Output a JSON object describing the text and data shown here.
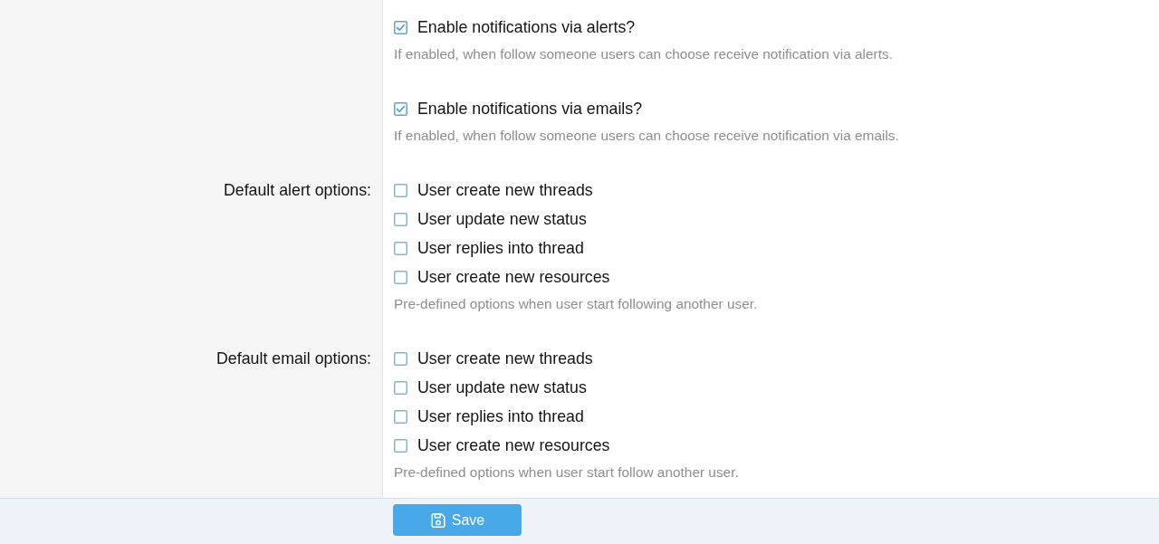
{
  "form": {
    "rows": [
      {
        "options": [
          {
            "label": "Enable notifications via alerts?",
            "checked": true
          }
        ],
        "explain": "If enabled, when follow someone users can choose receive notification via alerts."
      },
      {
        "options": [
          {
            "label": "Enable notifications via emails?",
            "checked": true
          }
        ],
        "explain": "If enabled, when follow someone users can choose receive notification via emails."
      },
      {
        "label": "Default alert options:",
        "options": [
          {
            "label": "User create new threads",
            "checked": false
          },
          {
            "label": "User update new status",
            "checked": false
          },
          {
            "label": "User replies into thread",
            "checked": false
          },
          {
            "label": "User create new resources",
            "checked": false
          }
        ],
        "explain": "Pre-defined options when user start following another user."
      },
      {
        "label": "Default email options:",
        "options": [
          {
            "label": "User create new threads",
            "checked": false
          },
          {
            "label": "User update new status",
            "checked": false
          },
          {
            "label": "User replies into thread",
            "checked": false
          },
          {
            "label": "User create new resources",
            "checked": false
          }
        ],
        "explain": "Pre-defined options when user start follow another user."
      }
    ]
  },
  "footer": {
    "save_button": {
      "label": "Save"
    }
  }
}
